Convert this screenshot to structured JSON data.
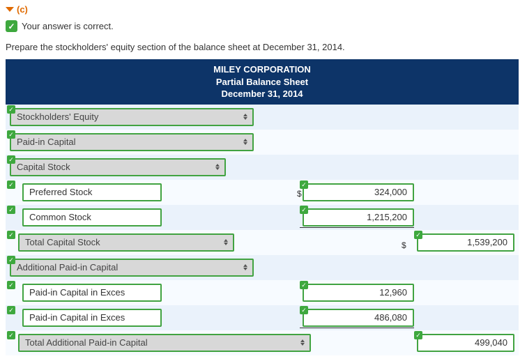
{
  "section": {
    "label": "(c)"
  },
  "feedback": {
    "text": "Your answer is correct."
  },
  "instruction": "Prepare the stockholders' equity section of the balance sheet at December 31, 2014.",
  "title": {
    "line1": "MILEY CORPORATION",
    "line2": "Partial Balance Sheet",
    "line3": "December 31, 2014"
  },
  "rows": {
    "r1": "Stockholders' Equity",
    "r2": "Paid-in Capital",
    "r3": "Capital Stock",
    "r4": {
      "label": "Preferred Stock",
      "amount": "324,000"
    },
    "r5": {
      "label": "Common Stock",
      "amount": "1,215,200"
    },
    "r6": {
      "label": "Total Capital Stock",
      "total": "1,539,200"
    },
    "r7": "Additional Paid-in Capital",
    "r8": {
      "label": "Paid-in Capital in Exces",
      "amount": "12,960"
    },
    "r9": {
      "label": "Paid-in Capital in Exces",
      "amount": "486,080"
    },
    "r10": {
      "label": "Total Additional Paid-in Capital",
      "total": "499,040"
    }
  }
}
